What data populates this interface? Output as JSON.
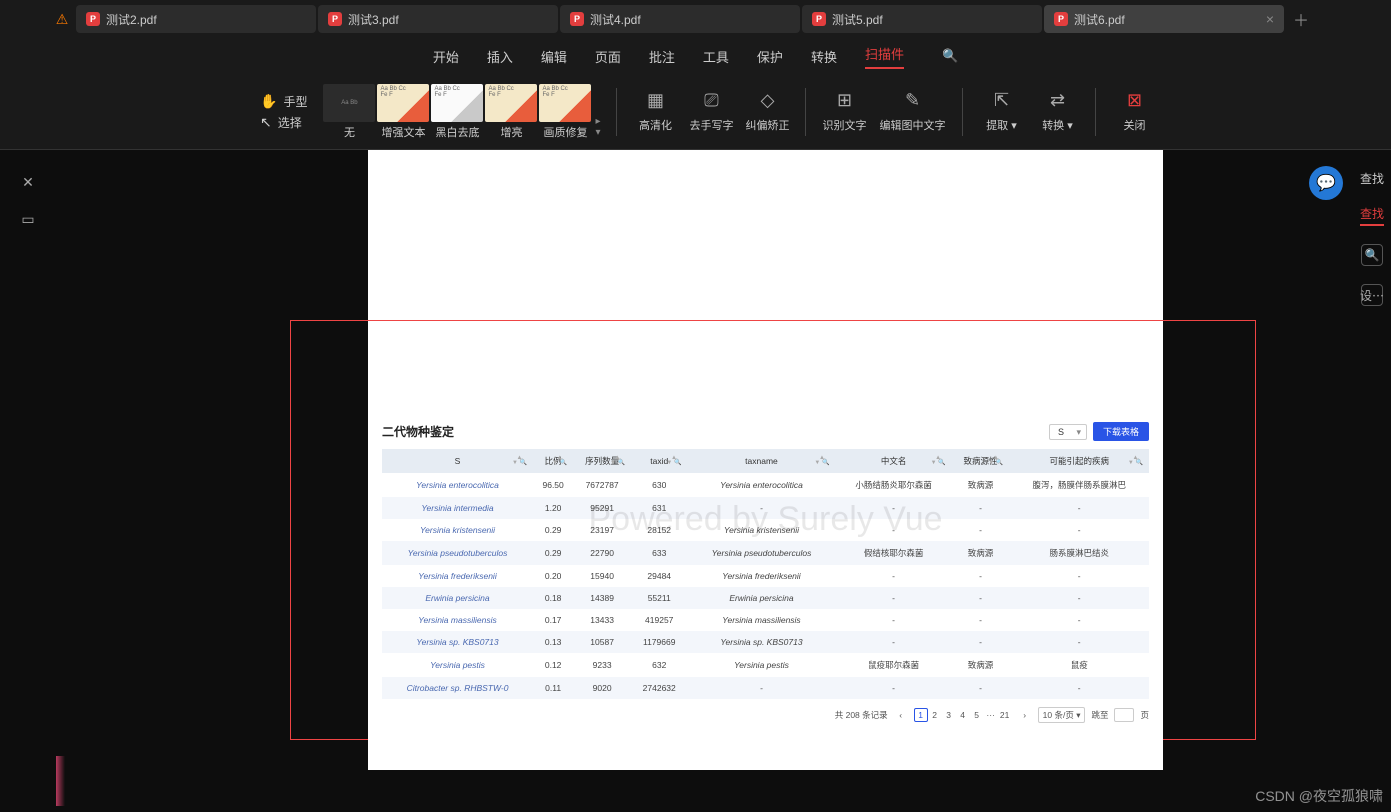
{
  "tabs": [
    "测试2.pdf",
    "测试3.pdf",
    "测试4.pdf",
    "测试5.pdf",
    "测试6.pdf"
  ],
  "activeTab": 4,
  "menus": [
    "开始",
    "插入",
    "编辑",
    "页面",
    "批注",
    "工具",
    "保护",
    "转换",
    "扫描件"
  ],
  "activeMenu": 8,
  "toolbarLeft": {
    "hand": "手型",
    "select": "选择"
  },
  "thumbs": [
    "无",
    "增强文本",
    "黑白去底",
    "增亮",
    "画质修复"
  ],
  "tools1": [
    "高清化",
    "去手写字",
    "纠偏矫正"
  ],
  "tools2": [
    "识别文字",
    "编辑图中文字"
  ],
  "tools3": [
    "提取",
    "转换"
  ],
  "toolClose": "关闭",
  "rightPanel": {
    "find": "查找",
    "findReplace": "查找",
    "settings": "设⋯"
  },
  "doc": {
    "title": "二代物种鉴定",
    "selectVal": "S",
    "download": "下载表格",
    "watermark": "Powered by Surely Vue",
    "headers": [
      "S",
      "比例",
      "序列数量",
      "taxid",
      "taxname",
      "中文名",
      "致病源性",
      "可能引起的疾病"
    ],
    "rows": [
      [
        "Yersinia enterocolitica",
        "96.50",
        "7672787",
        "630",
        "Yersinia enterocolitica",
        "小肠结肠炎耶尔森菌",
        "致病源",
        "腹泻，肠膜伴肠系膜淋巴"
      ],
      [
        "Yersinia intermedia",
        "1.20",
        "95291",
        "631",
        "-",
        "-",
        "-",
        "-"
      ],
      [
        "Yersinia kristensenii",
        "0.29",
        "23197",
        "28152",
        "Yersinia kristensenii",
        "-",
        "-",
        "-"
      ],
      [
        "Yersinia pseudotuberculos",
        "0.29",
        "22790",
        "633",
        "Yersinia pseudotuberculos",
        "假结核耶尔森菌",
        "致病源",
        "肠系膜淋巴结炎"
      ],
      [
        "Yersinia frederiksenii",
        "0.20",
        "15940",
        "29484",
        "Yersinia frederiksenii",
        "-",
        "-",
        "-"
      ],
      [
        "Erwinia persicina",
        "0.18",
        "14389",
        "55211",
        "Erwinia persicina",
        "-",
        "-",
        "-"
      ],
      [
        "Yersinia massiliensis",
        "0.17",
        "13433",
        "419257",
        "Yersinia massiliensis",
        "-",
        "-",
        "-"
      ],
      [
        "Yersinia sp. KBS0713",
        "0.13",
        "10587",
        "1179669",
        "Yersinia sp. KBS0713",
        "-",
        "-",
        "-"
      ],
      [
        "Yersinia pestis",
        "0.12",
        "9233",
        "632",
        "Yersinia pestis",
        "鼠疫耶尔森菌",
        "致病源",
        "鼠疫"
      ],
      [
        "Citrobacter sp. RHBSTW-0",
        "0.11",
        "9020",
        "2742632",
        "-",
        "-",
        "-",
        "-"
      ]
    ],
    "pager": {
      "total": "共 208 条记录",
      "pages": [
        "1",
        "2",
        "3",
        "4",
        "5",
        "···",
        "21"
      ],
      "perPage": "10 条/页",
      "jumpTo": "跳至",
      "pageUnit": "页"
    }
  },
  "csdn": "CSDN @夜空孤狼啸"
}
